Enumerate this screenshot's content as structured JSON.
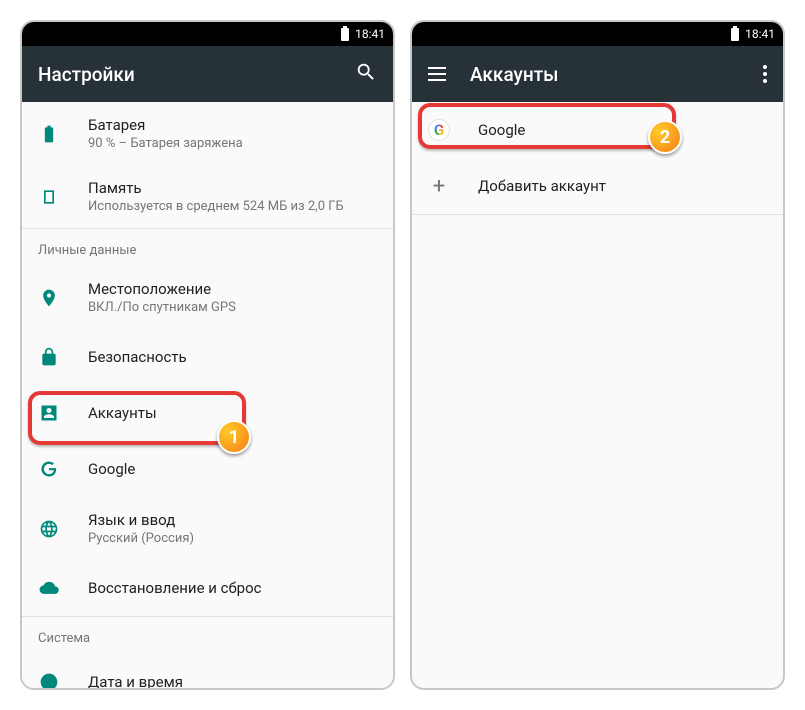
{
  "statusbar": {
    "time": "18:41"
  },
  "left": {
    "appbar_title": "Настройки",
    "items": {
      "battery": {
        "label": "Батарея",
        "sub": "90 % – Батарея заряжена"
      },
      "memory": {
        "label": "Память",
        "sub": "Используется в среднем 524 МБ из 2,0 ГБ"
      },
      "section_personal": "Личные данные",
      "location": {
        "label": "Местоположение",
        "sub": "ВКЛ./По спутникам GPS"
      },
      "security": {
        "label": "Безопасность"
      },
      "accounts": {
        "label": "Аккаунты"
      },
      "google": {
        "label": "Google"
      },
      "language": {
        "label": "Язык и ввод",
        "sub": "Русский (Россия)"
      },
      "backup": {
        "label": "Восстановление и сброс"
      },
      "section_system": "Система",
      "datetime": {
        "label": "Дата и время"
      }
    }
  },
  "right": {
    "appbar_title": "Аккаунты",
    "items": {
      "google": {
        "label": "Google"
      },
      "add": {
        "label": "Добавить аккаунт"
      }
    }
  },
  "annotations": {
    "badge1": "1",
    "badge2": "2"
  }
}
